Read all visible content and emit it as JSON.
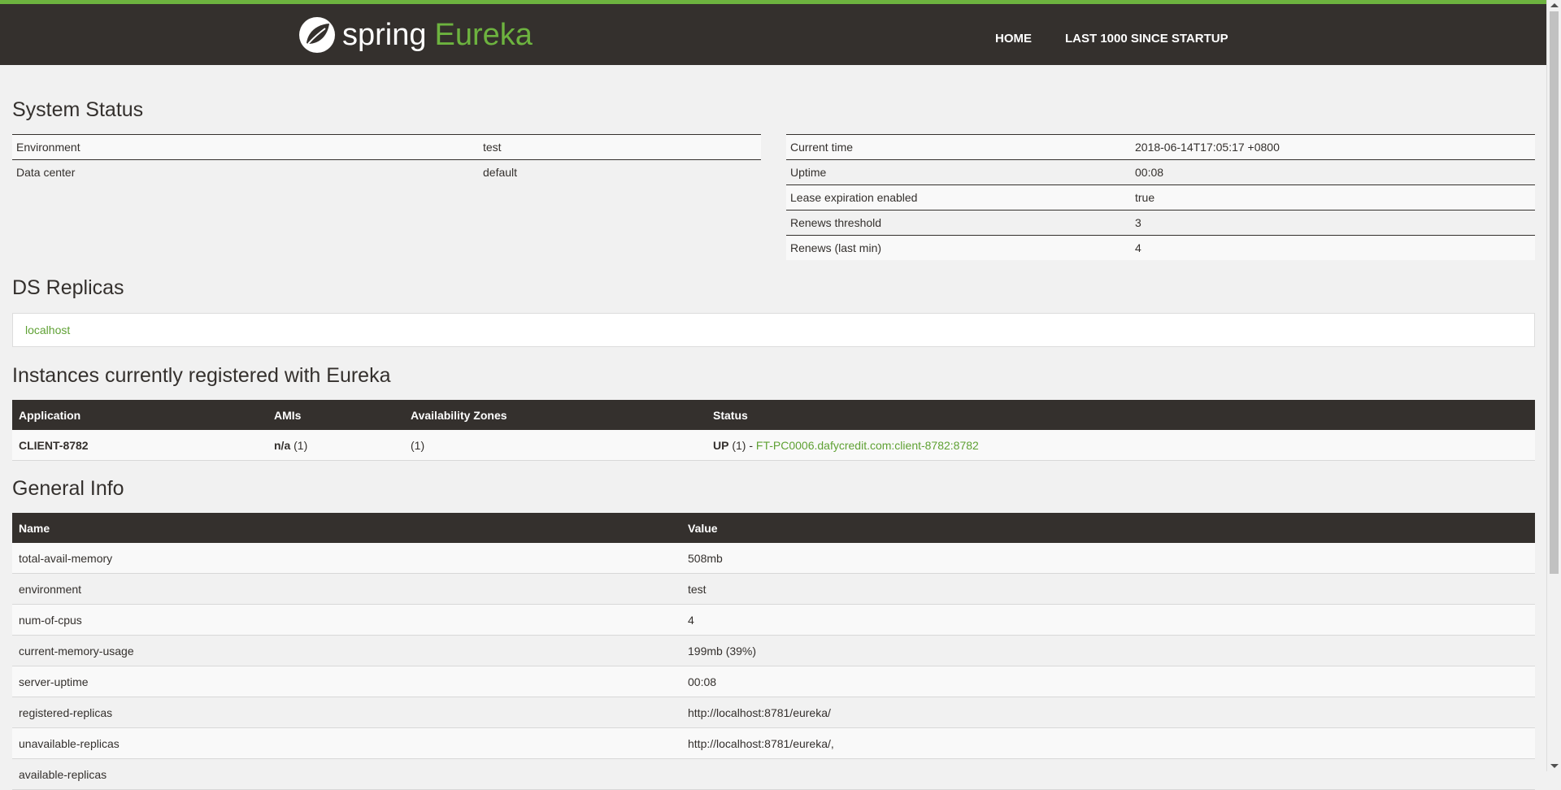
{
  "brand": {
    "logo_text": "spring",
    "product": "Eureka"
  },
  "nav": {
    "home": "HOME",
    "last1000": "LAST 1000 SINCE STARTUP"
  },
  "system_status": {
    "title": "System Status",
    "left": [
      {
        "name": "Environment",
        "value": "test"
      },
      {
        "name": "Data center",
        "value": "default"
      }
    ],
    "right": [
      {
        "name": "Current time",
        "value": "2018-06-14T17:05:17 +0800"
      },
      {
        "name": "Uptime",
        "value": "00:08"
      },
      {
        "name": "Lease expiration enabled",
        "value": "true"
      },
      {
        "name": "Renews threshold",
        "value": "3"
      },
      {
        "name": "Renews (last min)",
        "value": "4"
      }
    ]
  },
  "ds_replicas": {
    "title": "DS Replicas",
    "items": [
      "localhost"
    ]
  },
  "instances": {
    "title": "Instances currently registered with Eureka",
    "headers": [
      "Application",
      "AMIs",
      "Availability Zones",
      "Status"
    ],
    "rows": [
      {
        "application": "CLIENT-8782",
        "amis": "n/a",
        "amis_count": "(1)",
        "zones": "(1)",
        "status": "UP",
        "status_count": "(1) -",
        "instance_link": "FT-PC0006.dafycredit.com:client-8782:8782"
      }
    ]
  },
  "general_info": {
    "title": "General Info",
    "headers": [
      "Name",
      "Value"
    ],
    "rows": [
      {
        "name": "total-avail-memory",
        "value": "508mb"
      },
      {
        "name": "environment",
        "value": "test"
      },
      {
        "name": "num-of-cpus",
        "value": "4"
      },
      {
        "name": "current-memory-usage",
        "value": "199mb (39%)"
      },
      {
        "name": "server-uptime",
        "value": "00:08"
      },
      {
        "name": "registered-replicas",
        "value": "http://localhost:8781/eureka/"
      },
      {
        "name": "unavailable-replicas",
        "value": "http://localhost:8781/eureka/,"
      },
      {
        "name": "available-replicas",
        "value": ""
      }
    ]
  },
  "colors": {
    "header_bg": "#34302d",
    "accent": "#6db33f",
    "link": "#5fa134",
    "page_bg": "#f1f1f1"
  },
  "icons": {
    "logo": "spring-leaf-icon"
  }
}
